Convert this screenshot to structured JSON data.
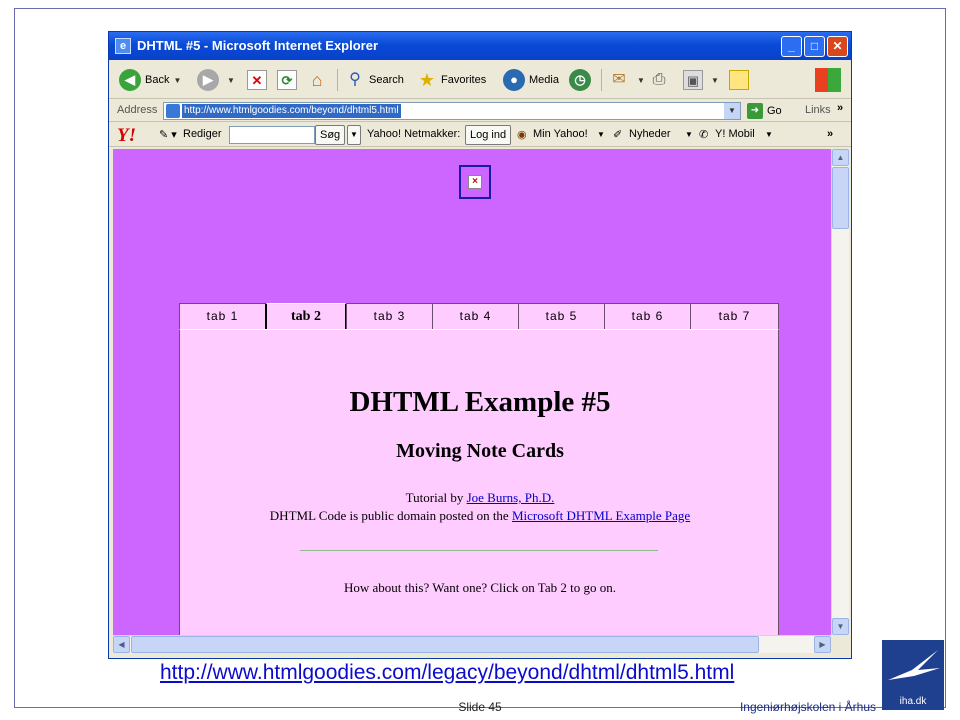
{
  "browser": {
    "title": "DHTML #5 - Microsoft Internet Explorer",
    "title_icon": "e",
    "window_buttons": {
      "minimize": "_",
      "maximize": "□",
      "close": "✕"
    },
    "toolbar": {
      "back": "Back",
      "search": "Search",
      "favorites": "Favorites",
      "media": "Media"
    },
    "address": {
      "label": "Address",
      "url": "http://www.htmlgoodies.com/beyond/dhtml5.html",
      "go": "Go",
      "links": "Links"
    },
    "yahoo_bar": {
      "logo": "Y!",
      "edit": "Rediger",
      "search_btn": "Søg",
      "netmakker_label": "Yahoo! Netmakker:",
      "login_btn": "Log ind",
      "my_yahoo": "Min Yahoo!",
      "news": "Nyheder",
      "mobile": "Y! Mobil"
    }
  },
  "page": {
    "tabs": [
      "tab 1",
      "tab 2",
      "tab 3",
      "tab 4",
      "tab 5",
      "tab 6",
      "tab 7"
    ],
    "active_tab_index": 1,
    "card": {
      "title": "DHTML Example #5",
      "subtitle": "Moving Note Cards",
      "tutorial_prefix": "Tutorial by ",
      "tutorial_link": "Joe Burns, Ph.D.",
      "code_prefix": "DHTML Code is public domain posted on the ",
      "code_link": "Microsoft DHTML Example Page",
      "prompt": "How about this? Want one? Click on Tab 2 to go on."
    }
  },
  "slide": {
    "caption_url": "http://www.htmlgoodies.com/legacy/beyond/dhtml/dhtml5.html",
    "slide_number": "Slide 45",
    "organization": "Ingeniørhøjskolen i Århus",
    "logo_text": "iha.dk"
  },
  "colors": {
    "page_background": "#cc66ff",
    "card_background": "#ffccff",
    "titlebar": "#0a4ad6"
  }
}
